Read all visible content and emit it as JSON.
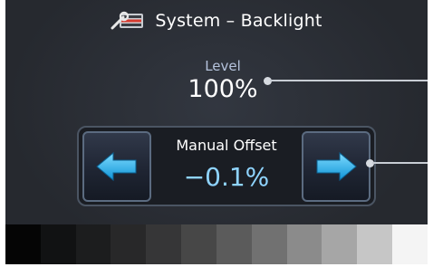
{
  "header": {
    "title": "System – Backlight",
    "icon": "wrench-settings-icon"
  },
  "level": {
    "label": "Level",
    "value": "100%"
  },
  "manual_offset": {
    "label": "Manual Offset",
    "value": "−0.1%",
    "decrease_icon": "arrow-left-icon",
    "increase_icon": "arrow-right-icon"
  },
  "gray_ramp": [
    "#050505",
    "#111213",
    "#1c1d1e",
    "#282829",
    "#363637",
    "#474747",
    "#5b5b5b",
    "#717171",
    "#8b8b8b",
    "#a6a6a6",
    "#c6c6c6",
    "#f4f4f4"
  ],
  "colors": {
    "background": "#26292f",
    "value_cyan": "#8fd4ff",
    "arrow_fill": "#22b9f2",
    "label_blue": "#b5c3dc"
  }
}
